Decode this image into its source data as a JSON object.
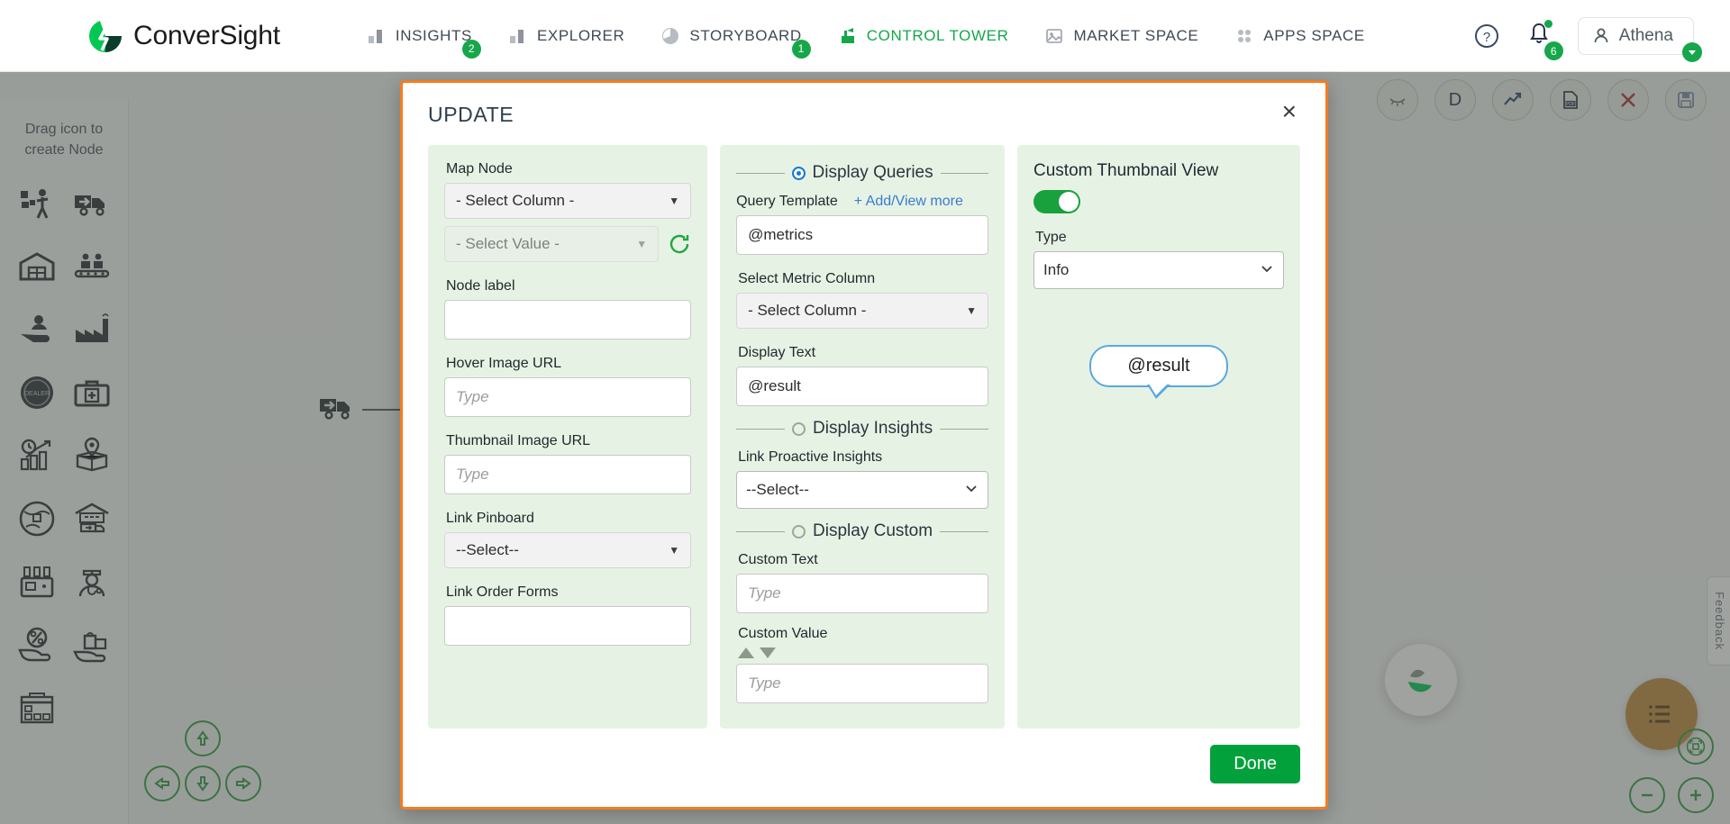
{
  "brand": {
    "name": "ConverSight",
    "logo_icon": "conversight-logo-icon",
    "colors": {
      "green": "#00c853",
      "dark_green": "#0b3d2c"
    }
  },
  "nav": {
    "items": [
      {
        "label": "INSIGHTS",
        "icon": "bar-chart-icon",
        "badge": "2",
        "active": false
      },
      {
        "label": "EXPLORER",
        "icon": "bar-chart-icon",
        "badge": "",
        "active": false
      },
      {
        "label": "STORYBOARD",
        "icon": "clock-pie-icon",
        "badge": "1",
        "active": false
      },
      {
        "label": "CONTROL TOWER",
        "icon": "control-tower-icon",
        "badge": "",
        "active": true
      },
      {
        "label": "MARKET SPACE",
        "icon": "market-space-icon",
        "badge": "",
        "active": false
      },
      {
        "label": "APPS SPACE",
        "icon": "apps-grid-icon",
        "badge": "",
        "active": false
      }
    ],
    "active_color": "#14a84b"
  },
  "topright": {
    "help_icon": "help-circle-icon",
    "bell_icon": "bell-icon",
    "bell_badge": "6",
    "user_name": "Athena",
    "user_icon": "person-icon",
    "caret_icon": "chevron-down-icon"
  },
  "workspace": {
    "toolbar": [
      {
        "name": "hide-icon",
        "glyph": "closed-eye"
      },
      {
        "name": "data-icon",
        "glyph": "D"
      },
      {
        "name": "trend-icon",
        "glyph": "trend-arrow"
      },
      {
        "name": "pdf-icon",
        "glyph": "PDF"
      },
      {
        "name": "delete-icon",
        "glyph": "x"
      },
      {
        "name": "save-icon",
        "glyph": "floppy"
      }
    ],
    "palette_title": "Drag icon to create Node",
    "palette_icons": [
      "worker-blocks-icon",
      "truck-delivery-icon",
      "warehouse-icon",
      "assembly-line-icon",
      "customer-hand-icon",
      "factory-icon",
      "dealer-badge-icon",
      "medical-kit-icon",
      "analytics-growth-icon",
      "package-location-icon",
      "globe-shipping-icon",
      "distribution-center-icon",
      "lab-equipment-icon",
      "doctor-icon",
      "discount-hand-icon",
      "retail-bag-hand-icon",
      "store-front-icon"
    ],
    "canvas_node_icon": "truck-delivery-icon",
    "pan_controls": [
      "pan-up",
      "pan-left",
      "pan-down",
      "pan-right"
    ],
    "zoom_controls": [
      "zoom-out",
      "zoom-in"
    ],
    "fit_control": "fit-to-screen",
    "menu_fab_icon": "list-menu-icon",
    "assistant_fab_icon": "athena-assistant-icon",
    "feedback_label": "Feedback"
  },
  "modal": {
    "title": "UPDATE",
    "close_label": "×",
    "accent_border": "#f47c20",
    "left": {
      "map_node_label": "Map Node",
      "map_node_column": "- Select Column -",
      "map_node_value": "- Select Value -",
      "refresh_icon": "refresh-icon",
      "node_label_label": "Node label",
      "node_label_value": "",
      "hover_image_label": "Hover Image URL",
      "hover_image_placeholder": "Type",
      "thumbnail_image_label": "Thumbnail Image URL",
      "thumbnail_image_placeholder": "Type",
      "link_pinboard_label": "Link Pinboard",
      "link_pinboard_value": "--Select--",
      "link_order_forms_label": "Link Order Forms",
      "link_order_forms_value": ""
    },
    "middle": {
      "display_queries_label": "Display Queries",
      "display_queries_selected": true,
      "query_template_label": "Query Template",
      "add_view_more_label": "+ Add/View more",
      "query_template_value": "@metrics",
      "select_metric_column_label": "Select Metric Column",
      "select_metric_column_value": "- Select Column -",
      "display_text_label": "Display Text",
      "display_text_value": "@result",
      "display_insights_label": "Display Insights",
      "display_insights_selected": false,
      "link_proactive_insights_label": "Link Proactive Insights",
      "link_proactive_insights_value": "--Select--",
      "display_custom_label": "Display Custom",
      "display_custom_selected": false,
      "custom_text_label": "Custom Text",
      "custom_text_placeholder": "Type",
      "custom_value_label": "Custom Value",
      "custom_value_placeholder": "Type"
    },
    "right": {
      "title": "Custom Thumbnail View",
      "toggle_on": true,
      "type_label": "Type",
      "type_value": "Info",
      "preview_bubble_text": "@result"
    },
    "done_label": "Done"
  }
}
